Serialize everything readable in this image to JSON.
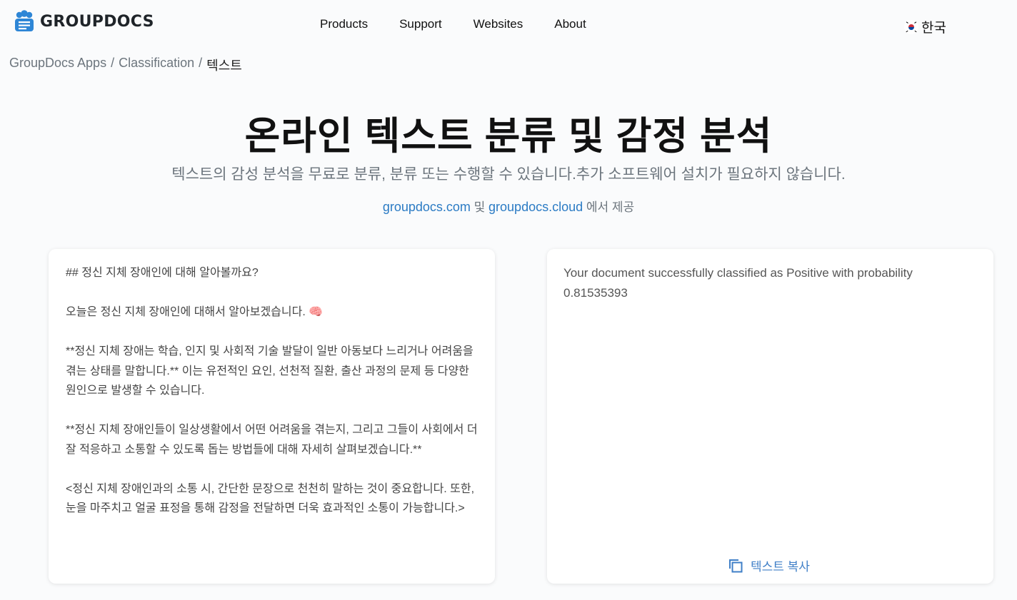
{
  "header": {
    "logo_text": "GROUPDOCS",
    "nav": [
      "Products",
      "Support",
      "Websites",
      "About"
    ],
    "language": "한국"
  },
  "breadcrumb": {
    "items": [
      "GroupDocs Apps",
      "Classification"
    ],
    "current": "텍스트"
  },
  "hero": {
    "title": "온라인 텍스트 분류 및 감정 분석",
    "subtitle": "텍스트의 감성 분석을 무료로 분류, 분류 또는 수행할 수 있습니다.추가 소프트웨어 설치가 필요하지 않습니다.",
    "provided_link1": "groupdocs.com",
    "provided_and": "및",
    "provided_link2": "groupdocs.cloud",
    "provided_suffix": "에서 제공"
  },
  "input": {
    "text": "## 정신 지체 장애인에 대해 알아볼까요?\n\n오늘은 정신 지체 장애인에 대해서 알아보겠습니다. 🧠\n\n**정신 지체 장애는 학습, 인지 및 사회적 기술 발달이 일반 아동보다 느리거나 어려움을 겪는 상태를 말합니다.** 이는 유전적인 요인, 선천적 질환, 출산 과정의 문제 등 다양한 원인으로 발생할 수 있습니다.\n\n**정신 지체 장애인들이 일상생활에서 어떤 어려움을 겪는지, 그리고 그들이 사회에서 더 잘 적응하고 소통할 수 있도록 돕는 방법들에 대해 자세히 살펴보겠습니다.**\n\n<정신 지체 장애인과의 소통 시, 간단한 문장으로 천천히 말하는 것이 중요합니다. 또한, 눈을 마주치고 얼굴 표정을 통해 감정을 전달하면 더욱 효과적인 소통이 가능합니다.>"
  },
  "result": {
    "text": "Your document successfully classified as Positive with probability 0.81535393",
    "copy_label": "텍스트 복사"
  },
  "colors": {
    "accent": "#2b7bc4",
    "muted": "#6c757d",
    "logo_blue": "#2e86d6"
  }
}
